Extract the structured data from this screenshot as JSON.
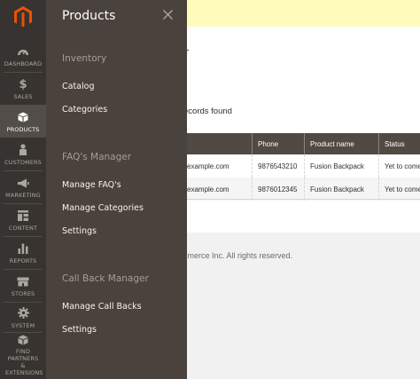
{
  "nav": {
    "items": [
      {
        "label": "DASHBOARD",
        "icon": "dashboard-icon"
      },
      {
        "label": "SALES",
        "icon": "dollar-icon"
      },
      {
        "label": "PRODUCTS",
        "icon": "box-icon",
        "active": true
      },
      {
        "label": "CUSTOMERS",
        "icon": "person-icon"
      },
      {
        "label": "MARKETING",
        "icon": "megaphone-icon"
      },
      {
        "label": "CONTENT",
        "icon": "content-grid-icon"
      },
      {
        "label": "REPORTS",
        "icon": "bar-chart-icon"
      },
      {
        "label": "STORES",
        "icon": "storefront-icon"
      },
      {
        "label": "SYSTEM",
        "icon": "gear-icon"
      },
      {
        "label": "FIND PARTNERS & EXTENSIONS",
        "icon": "cube-icon"
      }
    ]
  },
  "flyout": {
    "title": "Products",
    "sections": [
      {
        "heading": "Inventory",
        "links": [
          "Catalog",
          "Categories"
        ]
      },
      {
        "heading": "FAQ's Manager",
        "links": [
          "Manage FAQ's",
          "Manage Categories",
          "Settings"
        ]
      },
      {
        "heading": "Call Back Manager",
        "links": [
          "Manage Call Backs",
          "Settings"
        ]
      }
    ]
  },
  "page": {
    "records_text": "ecords found",
    "columns": [
      "Phone",
      "Product name",
      "Status"
    ],
    "rows": [
      {
        "email": "example.com",
        "phone": "9876543210",
        "product": "Fusion Backpack",
        "status": "Yet to come"
      },
      {
        "email": "example.com",
        "phone": "9876012345",
        "product": "Fusion Backpack",
        "status": "Yet to come"
      }
    ],
    "copyright": "mmerce Inc. All rights reserved."
  },
  "colors": {
    "nav_bg": "#373330",
    "flyout_bg": "#4a423d",
    "brand_orange": "#eb5202",
    "grid_header": "#514943",
    "notice": "#fffbbb"
  }
}
